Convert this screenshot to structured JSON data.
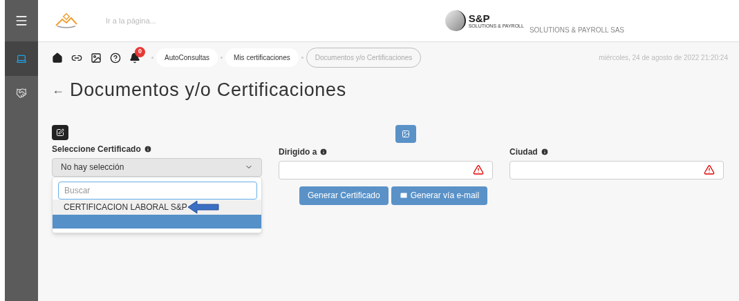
{
  "header": {
    "search_placeholder": "Ir a la página...",
    "company": "SOLUTIONS & PAYROLL SAS",
    "logo_text": "S&P",
    "logo_subtext": "SOLUTIONS & PAYROLL"
  },
  "sidebar": {
    "items": [
      {
        "kind": "laptop",
        "selected": true
      },
      {
        "kind": "handshake",
        "selected": false
      }
    ]
  },
  "toolbar": {
    "notification_count": "0"
  },
  "breadcrumbs": [
    {
      "label": "AutoConsultas",
      "current": false
    },
    {
      "label": "Mis certificaciones",
      "current": false
    },
    {
      "label": "Documentos y/o Certificaciones",
      "current": true
    }
  ],
  "datetime": "miércoles, 24 de agosto de 2022 21:20:24",
  "back_arrow": "←",
  "title": "Documentos y/o Certificaciones",
  "form": {
    "certificate": {
      "label": "Seleccione Certificado",
      "value": "No hay selección",
      "open": true,
      "search_placeholder": "Buscar",
      "options": [
        {
          "label": "CERTIFICACION LABORAL S&P",
          "hovered": true
        }
      ],
      "highlight_row": true
    },
    "addressed_to": {
      "label": "Dirigido a",
      "invalid": true
    },
    "city": {
      "label": "Ciudad",
      "invalid": true
    },
    "buttons": [
      {
        "label": "Generar Certificado",
        "kind": "plain"
      },
      {
        "label": "Generar vía e-mail",
        "kind": "email"
      }
    ]
  }
}
